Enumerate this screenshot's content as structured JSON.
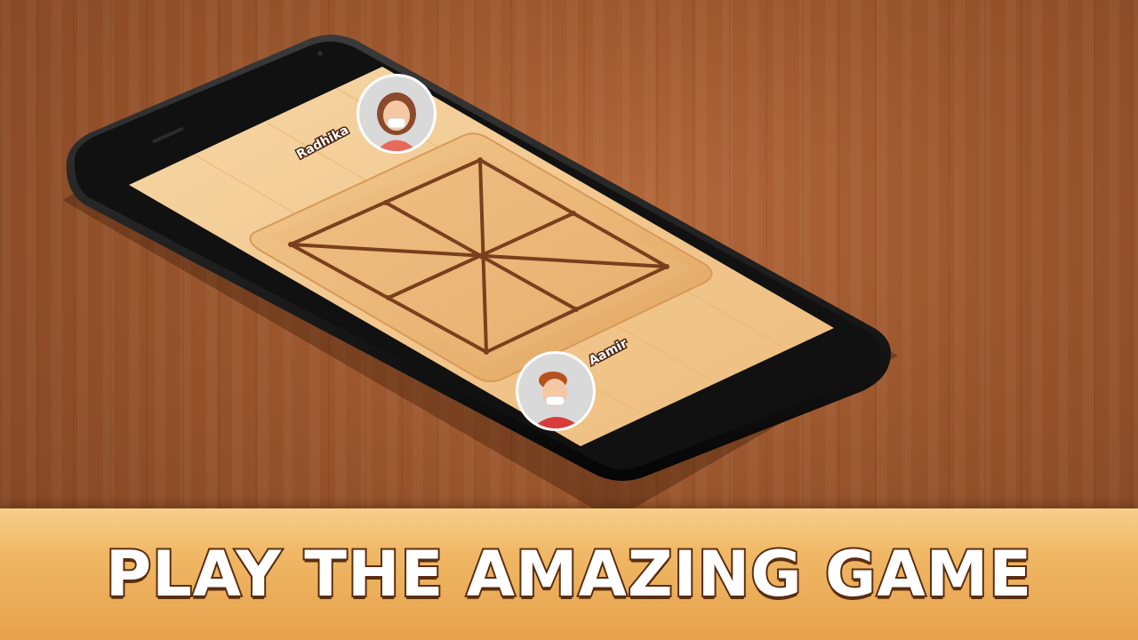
{
  "game": {
    "players": {
      "top": {
        "name": "Radhika",
        "avatar_icon": "girl-with-mask-icon"
      },
      "bottom": {
        "name": "Aamir",
        "avatar_icon": "boy-with-mask-icon"
      }
    },
    "board": {
      "type": "8-segment square board"
    }
  },
  "banner": {
    "text": "PLAY THE AMAZING GAME"
  },
  "colors": {
    "table_wood": "#9a552c",
    "screen_wood": "#f5cf9a",
    "board_lines": "#7a3f1c",
    "banner": "#f0b765",
    "phone_body": "#0e0e0e"
  }
}
